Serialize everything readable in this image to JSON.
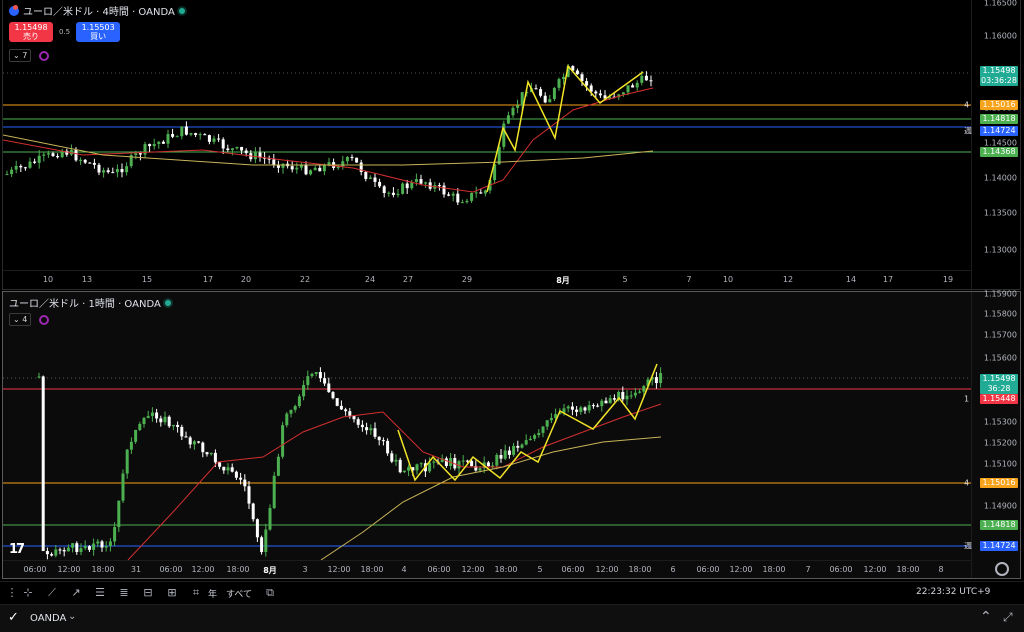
{
  "pane1": {
    "title": "ユーロ／米ドル · 4時間 · OANDA",
    "sell_price": "1.15498",
    "sell_label": "売り",
    "spread": "0.5",
    "buy_price": "1.15503",
    "buy_label": "買い",
    "indicator_count": "7",
    "y_ticks": [
      "1.16500",
      "1.16000",
      "1.15500",
      "1.15000",
      "1.14500",
      "1.14000",
      "1.13500",
      "1.13000"
    ],
    "x_ticks": [
      "10",
      "13",
      "15",
      "17",
      "20",
      "22",
      "24",
      "27",
      "29",
      "8月",
      "5",
      "7",
      "10",
      "12",
      "14",
      "17",
      "19"
    ],
    "price_tags": [
      {
        "value": "1.15498",
        "sub": "03:36:28",
        "color": "#22ab94",
        "label": ""
      },
      {
        "value": "1.15016",
        "sub": "",
        "color": "#f7a21b",
        "label": "4"
      },
      {
        "value": "1.14818",
        "sub": "",
        "color": "#4caf50",
        "label": ""
      },
      {
        "value": "1.14724",
        "sub": "",
        "color": "#2962ff",
        "label": "週"
      },
      {
        "value": "1.14368",
        "sub": "",
        "color": "#4caf50",
        "label": ""
      }
    ]
  },
  "pane2": {
    "title": "ユーロ／米ドル · 1時間 · OANDA",
    "indicator_count": "4",
    "y_ticks": [
      "1.15900",
      "1.15800",
      "1.15700",
      "1.15600",
      "1.15300",
      "1.15200",
      "1.15100",
      "1.14900",
      "1.14700"
    ],
    "x_ticks": [
      "06:00",
      "12:00",
      "18:00",
      "31",
      "06:00",
      "12:00",
      "18:00",
      "8月",
      "3",
      "12:00",
      "18:00",
      "4",
      "06:00",
      "12:00",
      "18:00",
      "5",
      "06:00",
      "12:00",
      "18:00",
      "6",
      "06:00",
      "12:00",
      "18:00",
      "7",
      "06:00",
      "12:00",
      "18:00",
      "8",
      "12:00"
    ],
    "price_tags": [
      {
        "value": "1.15498",
        "sub": "36:28",
        "color": "#22ab94",
        "label": ""
      },
      {
        "value": "1.15448",
        "sub": "",
        "color": "#f23645",
        "label": "1"
      },
      {
        "value": "1.15016",
        "sub": "",
        "color": "#f7a21b",
        "label": "4"
      },
      {
        "value": "1.14818",
        "sub": "",
        "color": "#4caf50",
        "label": ""
      },
      {
        "value": "1.14724",
        "sub": "",
        "color": "#2962ff",
        "label": "週"
      }
    ]
  },
  "toolbar": {
    "period_label": "年",
    "all_label": "すべて",
    "time": "22:23:32 UTC+9"
  },
  "bottom": {
    "broker": "OANDA"
  },
  "colors": {
    "up": "#4caf50",
    "down": "#ffffff",
    "ma_short": "#d32f2f",
    "ma_long": "#c9b458",
    "zigzag": "#f2e427"
  }
}
